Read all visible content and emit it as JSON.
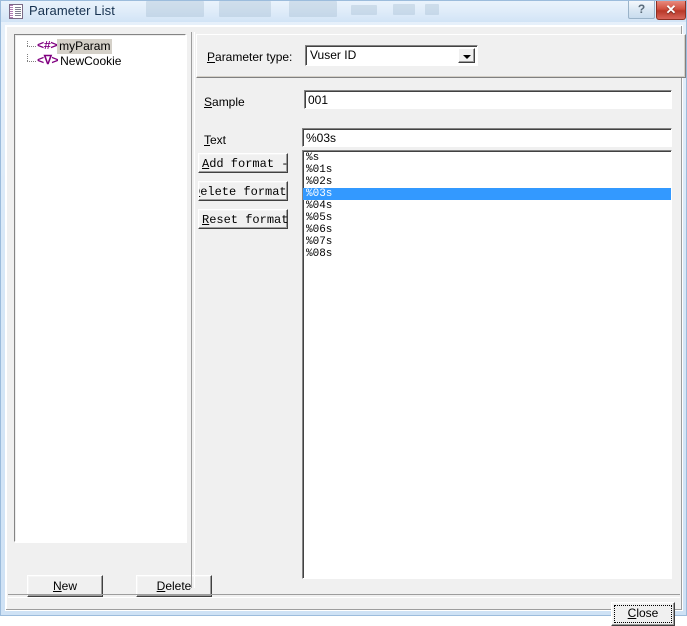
{
  "window": {
    "title": "Parameter List",
    "title_icon": "document-list-icon",
    "help_button": "?",
    "close_button": "✕"
  },
  "tree": {
    "items": [
      {
        "icon": "<#>",
        "icon_name": "numeric-param-icon",
        "label": "myParam",
        "selected": true
      },
      {
        "icon": "<ᐁ>",
        "icon_name": "file-param-icon",
        "label": "NewCookie",
        "selected": false
      }
    ]
  },
  "left_buttons": {
    "new": {
      "pre": "",
      "accel": "N",
      "post": "ew"
    },
    "delete": {
      "pre": "",
      "accel": "D",
      "post": "elete"
    }
  },
  "parameter_type": {
    "label_pre": "",
    "label_accel": "P",
    "label_post": "arameter type:",
    "value": "Vuser ID",
    "options": [
      "Vuser ID"
    ]
  },
  "sample": {
    "label_pre": "",
    "label_accel": "S",
    "label_post": "ample",
    "value": "001"
  },
  "text": {
    "label_pre": "",
    "label_accel": "T",
    "label_post": "ext",
    "value": "%03s"
  },
  "format_buttons": [
    {
      "name": "add-format-button",
      "accel": "A",
      "pre": "",
      "post": "dd format ->"
    },
    {
      "name": "delete-format-button",
      "accel": "D",
      "pre": "",
      "post": "elete format <-"
    },
    {
      "name": "reset-formats-button",
      "accel": "R",
      "pre": "",
      "post": "eset formats"
    }
  ],
  "format_list": {
    "items": [
      "%s",
      "%01s",
      "%02s",
      "%03s",
      "%04s",
      "%05s",
      "%06s",
      "%07s",
      "%08s"
    ],
    "selected_index": 3,
    "selected_value": "%03s"
  },
  "close_button": {
    "pre": "",
    "accel": "C",
    "post": "lose"
  },
  "colors": {
    "selection_blue": "#3399ff",
    "tree_selection_gray": "#d4d0c8",
    "dialog_face": "#f0f0f0",
    "param_icon_purple": "#800080",
    "close_red": "#c0392b"
  }
}
